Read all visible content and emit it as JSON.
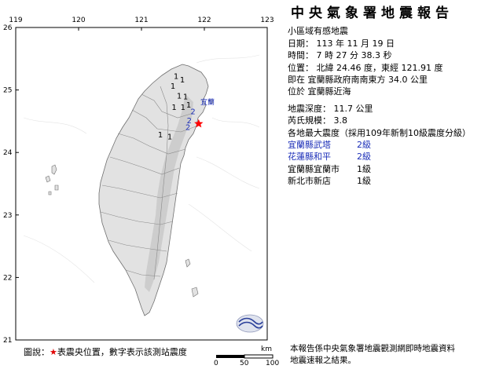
{
  "map": {
    "lon_ticks": [
      "119",
      "120",
      "121",
      "122",
      "123"
    ],
    "lat_ticks": [
      "26",
      "25",
      "24",
      "23",
      "22",
      "21"
    ],
    "epicenter": {
      "lon": 121.91,
      "lat": 24.46
    },
    "station_marks": [
      {
        "label": "1",
        "lon": 121.55,
        "lat": 25.18
      },
      {
        "label": "1",
        "lon": 121.65,
        "lat": 25.12
      },
      {
        "label": "1",
        "lon": 121.5,
        "lat": 25.02
      },
      {
        "label": "1",
        "lon": 121.6,
        "lat": 24.86
      },
      {
        "label": "1",
        "lon": 121.7,
        "lat": 24.85
      },
      {
        "label": "1",
        "lon": 121.75,
        "lat": 24.72
      },
      {
        "label": "1",
        "lon": 121.52,
        "lat": 24.68
      },
      {
        "label": "1",
        "lon": 121.66,
        "lat": 24.68
      },
      {
        "label": "1",
        "lon": 121.3,
        "lat": 24.24
      },
      {
        "label": "1",
        "lon": 121.45,
        "lat": 24.21
      },
      {
        "label": "2",
        "lon": 121.82,
        "lat": 24.61
      },
      {
        "label": "2",
        "lon": 121.76,
        "lat": 24.47
      },
      {
        "label": "2",
        "lon": 121.74,
        "lat": 24.36
      }
    ],
    "place_labels": [
      "宜蘭"
    ],
    "colors": {
      "sea": "#ffffff",
      "land": "#e2e2e2",
      "relief": "#c9c9c9",
      "star": "#ff0000",
      "intensity2": "#1c2fb8"
    }
  },
  "report": {
    "title": "中央氣象署地震報告",
    "type": "小區域有感地震",
    "date": "日期： 113 年 11 月 19 日",
    "time": "時間： 7 時 27 分 38.3 秒",
    "position": "位置： 北緯 24.46 度，東經 121.91 度",
    "relative": "即在 宜蘭縣政府南南東方 34.0 公里",
    "located_at": "位於 宜蘭縣近海",
    "depth": "地震深度： 11.7 公里",
    "magnitude": "芮氏規模： 3.8",
    "intensity_header": "各地最大震度（採用109年新制10級震度分級）",
    "stations": [
      {
        "name": "宜蘭縣武塔",
        "level": "2級",
        "highlight": true
      },
      {
        "name": "花蓮縣和平",
        "level": "2級",
        "highlight": true
      },
      {
        "name": "宜蘭縣宜蘭市",
        "level": "1級",
        "highlight": false
      },
      {
        "name": "新北市新店",
        "level": "1級",
        "highlight": false
      }
    ]
  },
  "legend": {
    "prefix": "圖說：",
    "star": "★",
    "text": "表震央位置，數字表示該測站震度"
  },
  "scale": {
    "unit": "km",
    "ticks": [
      "0",
      "50",
      "100"
    ]
  },
  "footer": {
    "line1": "本報告係中央氣象署地震觀測網即時地震資料",
    "line2": "地震速報之結果。"
  }
}
